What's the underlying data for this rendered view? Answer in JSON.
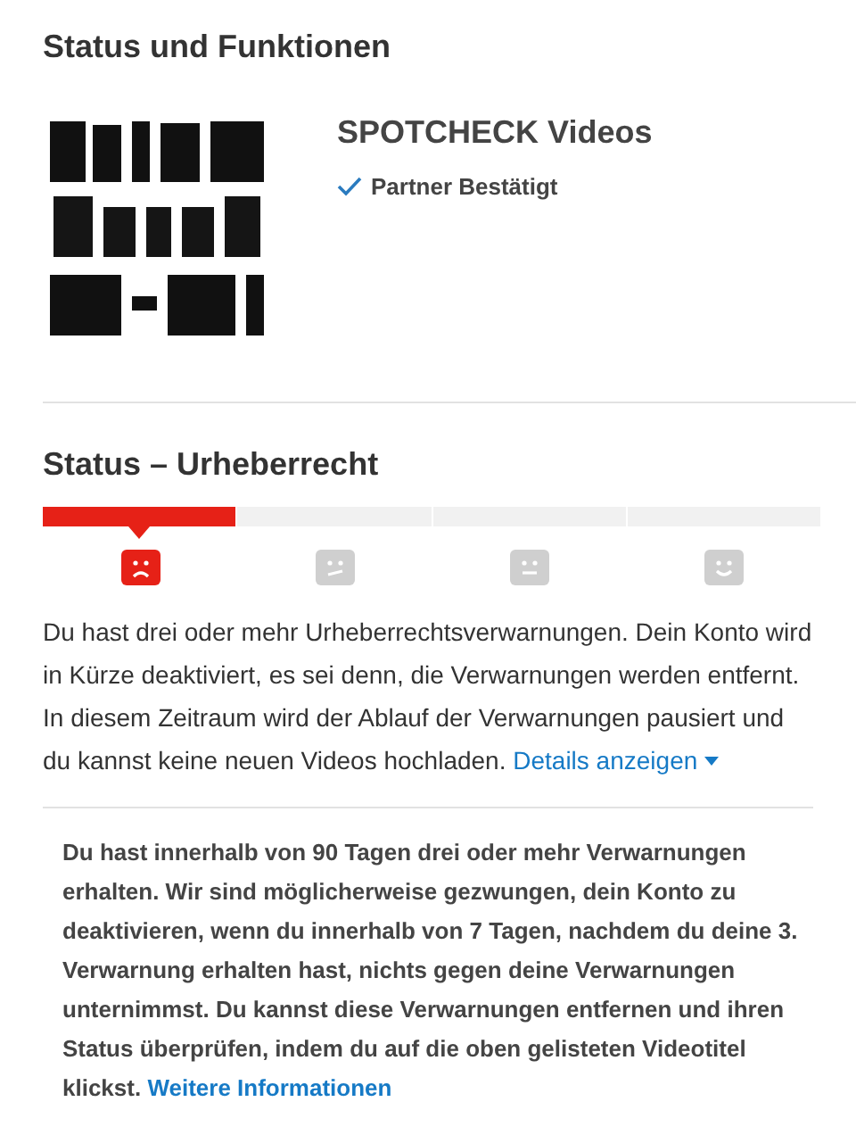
{
  "title": "Status und Funktionen",
  "channel": {
    "name": "SPOTCHECK Videos",
    "badge": "Partner Bestätigt"
  },
  "status": {
    "heading": "Status – Urheberrecht",
    "levels": [
      {
        "kind": "sad",
        "selected": true
      },
      {
        "kind": "skeptical",
        "selected": false
      },
      {
        "kind": "neutral",
        "selected": false
      },
      {
        "kind": "happy",
        "selected": false
      }
    ],
    "message": "Du hast drei oder mehr Urheberrechtsverwarnungen. Dein Konto wird in Kürze deaktiviert, es sei denn, die Verwarnungen werden entfernt. In diesem Zeitraum wird der Ablauf der Verwarnungen pausiert und du kannst keine neuen Videos hochladen.",
    "details_link": {
      "label": "Details anzeigen",
      "expanded": true
    },
    "details": "Du hast innerhalb von 90 Tagen drei oder mehr Verwarnungen erhalten. Wir sind möglicherweise gezwungen, dein Konto zu deaktivieren, wenn du innerhalb von 7 Tagen, nachdem du deine 3. Verwarnung erhalten hast, nichts gegen deine Verwarnungen unternimmst. Du kannst diese Verwarnungen entfernen und ihren Status überprüfen, indem du auf die oben gelisteten Videotitel klickst.",
    "more_link": "Weitere Informationen"
  }
}
